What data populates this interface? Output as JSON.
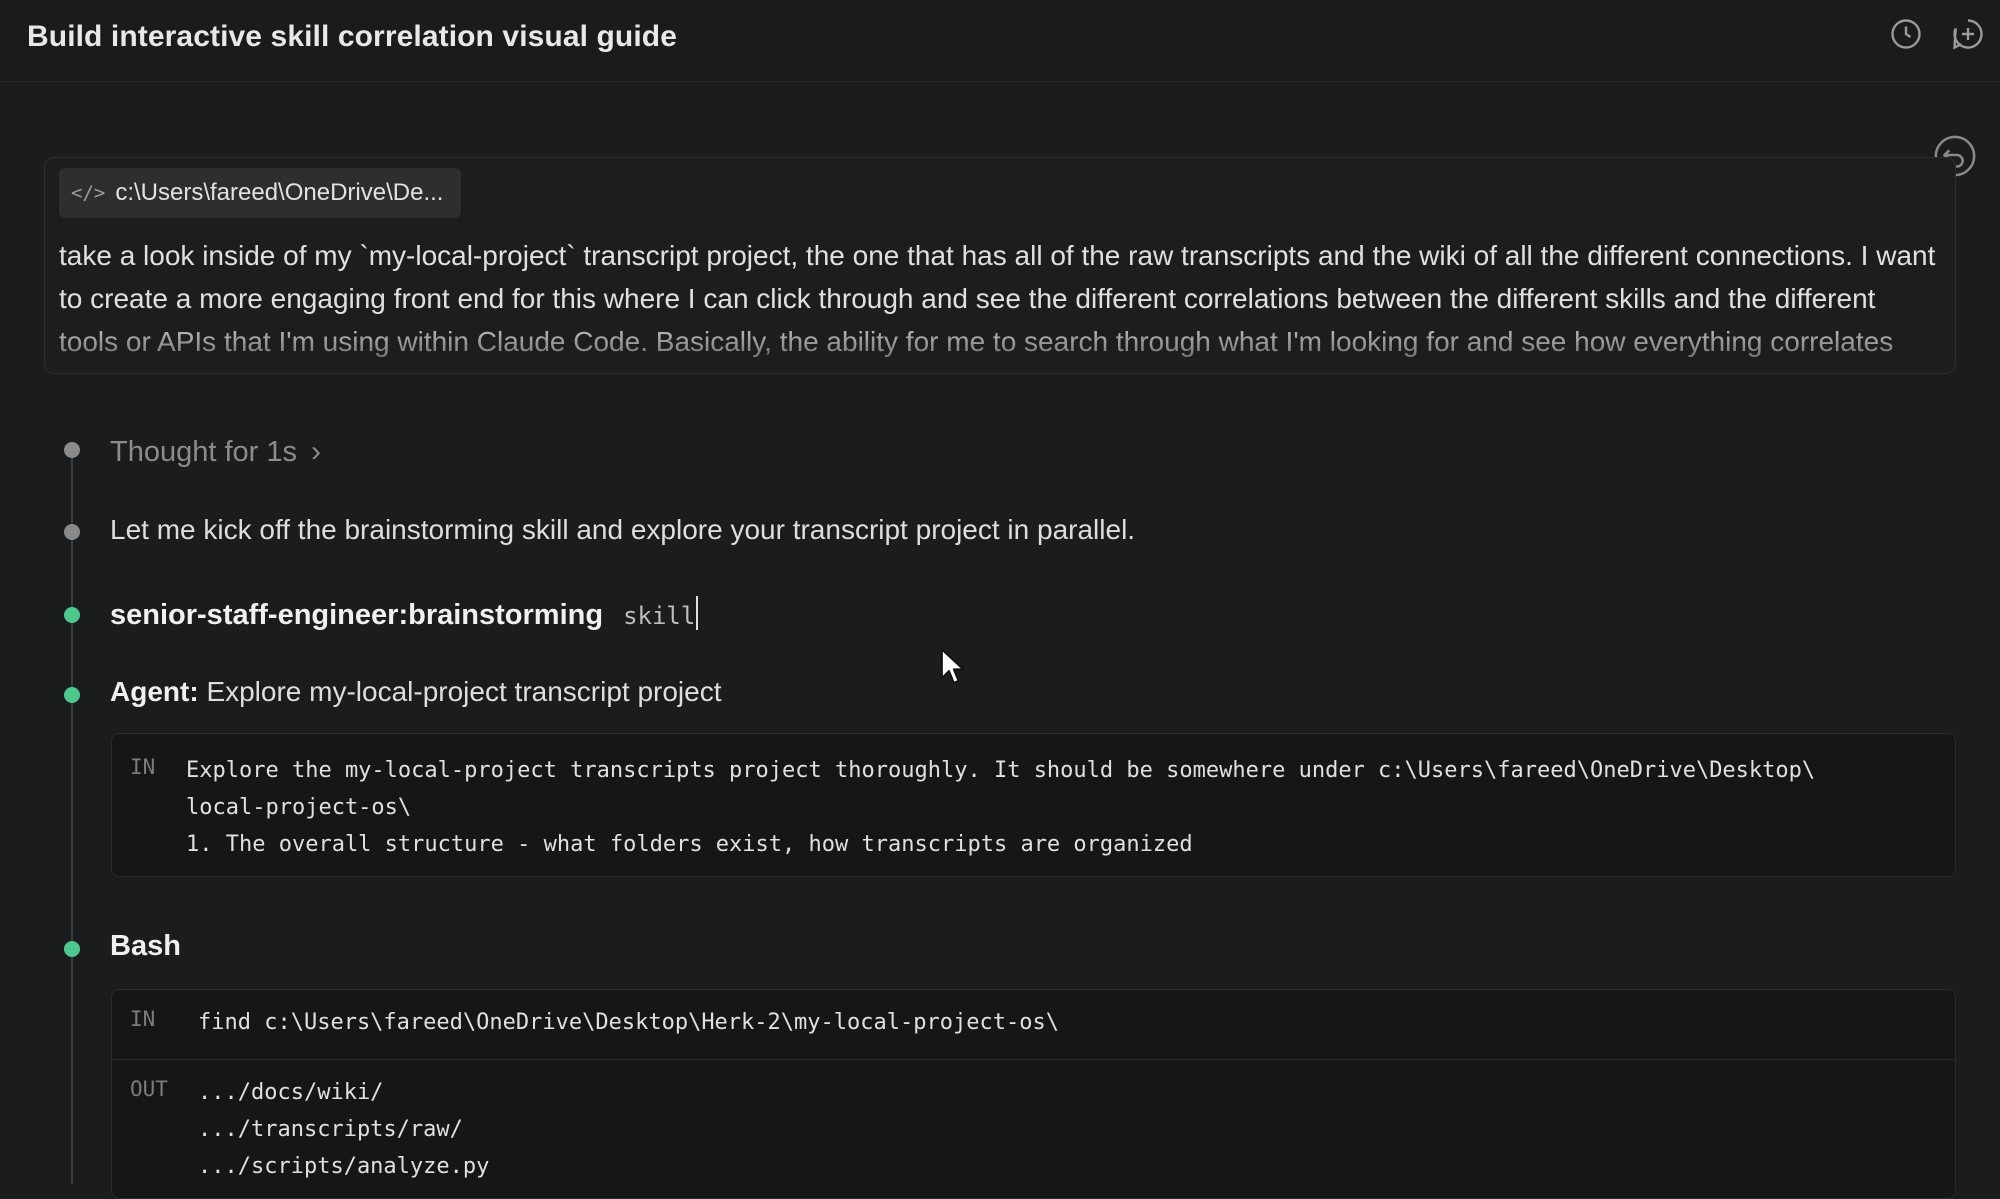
{
  "header": {
    "title": "Build interactive skill correlation visual guide",
    "history_icon": "clock-icon",
    "new_chat_icon": "plus-circle-icon"
  },
  "prompt": {
    "file_chip": "c:\\Users\\fareed\\OneDrive\\De...",
    "text": "take a look inside of my `my-local-project` transcript project, the one that has all of the raw transcripts and the wiki of all the different connections. I want to create a more engaging front end for this where I can click through and see the different correlations between the different skills and the different tools or APIs that I'm using within Claude Code. Basically, the ability for me to search through what I'm looking for and see how everything correlates",
    "undo_icon": "undo-icon"
  },
  "steps": {
    "thought": "Thought for 1s",
    "message": "Let me kick off the brainstorming skill and explore your transcript project in parallel.",
    "skill_name": "senior-staff-engineer:brainstorming",
    "skill_tag": "skill",
    "agent_label": "Agent:",
    "agent_desc": "Explore my-local-project transcript project",
    "agent_in_tag": "IN",
    "agent_in_lines": "Explore the my-local-project transcripts project thoroughly. It should be somewhere under c:\\Users\\fareed\\OneDrive\\Desktop\\\nlocal-project-os\\\n1. The overall structure - what folders exist, how transcripts are organized",
    "bash_label": "Bash",
    "bash_in_tag": "IN",
    "bash_in": "find c:\\Users\\fareed\\OneDrive\\Desktop\\Herk-2\\my-local-project-os\\",
    "bash_out_tag": "OUT",
    "bash_out": ".../docs/wiki/\n.../transcripts/raw/\n.../scripts/analyze.py"
  },
  "colors": {
    "background": "#1b1c1d",
    "success_dot": "#4ec98d",
    "pending_dot": "#8a8a8a"
  }
}
